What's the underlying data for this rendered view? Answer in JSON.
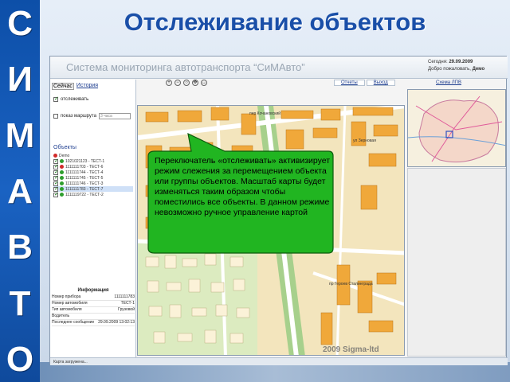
{
  "slide": {
    "title": "Отслеживание объектов",
    "side_letters": [
      "С",
      "И",
      "М",
      "А",
      "В",
      "Т",
      "О"
    ]
  },
  "app": {
    "title": "Система мониторинга автотранспорта “СиМАвто”",
    "header": {
      "today_label": "Сегодня:",
      "today_value": "29.09.2009",
      "welcome_label": "Добро пожаловать,",
      "welcome_user": "Демо"
    },
    "tabs": [
      "Сейчас",
      "История"
    ],
    "tracking_label": "отслеживать",
    "route_label": "показ маршрута",
    "route_select": "3 часа",
    "objects_title": "Объекты",
    "objects_group": "Demo",
    "objects": [
      {
        "label": "1021021123 - ТЕСТ-1",
        "color": "#2e9e2e",
        "selected": false
      },
      {
        "label": "1111111703 - ТЕСТ-6",
        "color": "#d12a2a",
        "selected": false
      },
      {
        "label": "1111111744 - ТЕСТ-4",
        "color": "#2e9e2e",
        "selected": false
      },
      {
        "label": "1111111745 - ТЕСТ-5",
        "color": "#2e9e2e",
        "selected": false
      },
      {
        "label": "1111111746 - ТЕСТ-3",
        "color": "#2e9e2e",
        "selected": false
      },
      {
        "label": "1111111783 - ТЕСТ-7",
        "color": "#2e9e2e",
        "selected": true
      },
      {
        "label": "1111119722 - ТЕСТ-2",
        "color": "#2e9e2e",
        "selected": false
      }
    ],
    "info": {
      "title": "Информация",
      "rows": [
        {
          "k": "Номер прибора",
          "v": "1111111783"
        },
        {
          "k": "Номер автомобиля",
          "v": "ТЕСТ-1"
        },
        {
          "k": "Тип автомобиля",
          "v": "Грузовой"
        },
        {
          "k": "Водитель",
          "v": ""
        },
        {
          "k": "Последнее сообщение",
          "v": "29.09.2009 13:02:13"
        }
      ]
    },
    "toolbar_icons": [
      "zoom-in-icon",
      "zoom-out-icon",
      "zoom-reset-icon",
      "pan-icon",
      "measure-icon"
    ],
    "links": [
      "Отчеты",
      "Выход"
    ],
    "overview_link": "Схема ЛПВ",
    "copyright": "2009 Sigma-ltd",
    "street_labels": [
      "пер Кочановский",
      "ул Зерновая",
      "пр Героев Сталинграда"
    ],
    "status": "Карта загружена..."
  },
  "callout": {
    "text": "Переключатель «отслеживать» активизирует режим слежения за перемещением объекта или группы объектов. Масштаб карты будет изменяться таким образом чтобы поместились все объекты. В данном режиме невозможно ручное управление картой"
  },
  "colors": {
    "brand_blue": "#1a4fa8",
    "callout_green": "#21b521",
    "map_bg": "#f3e5bd",
    "building": "#f0a83a",
    "road_green": "#a7d08c"
  }
}
